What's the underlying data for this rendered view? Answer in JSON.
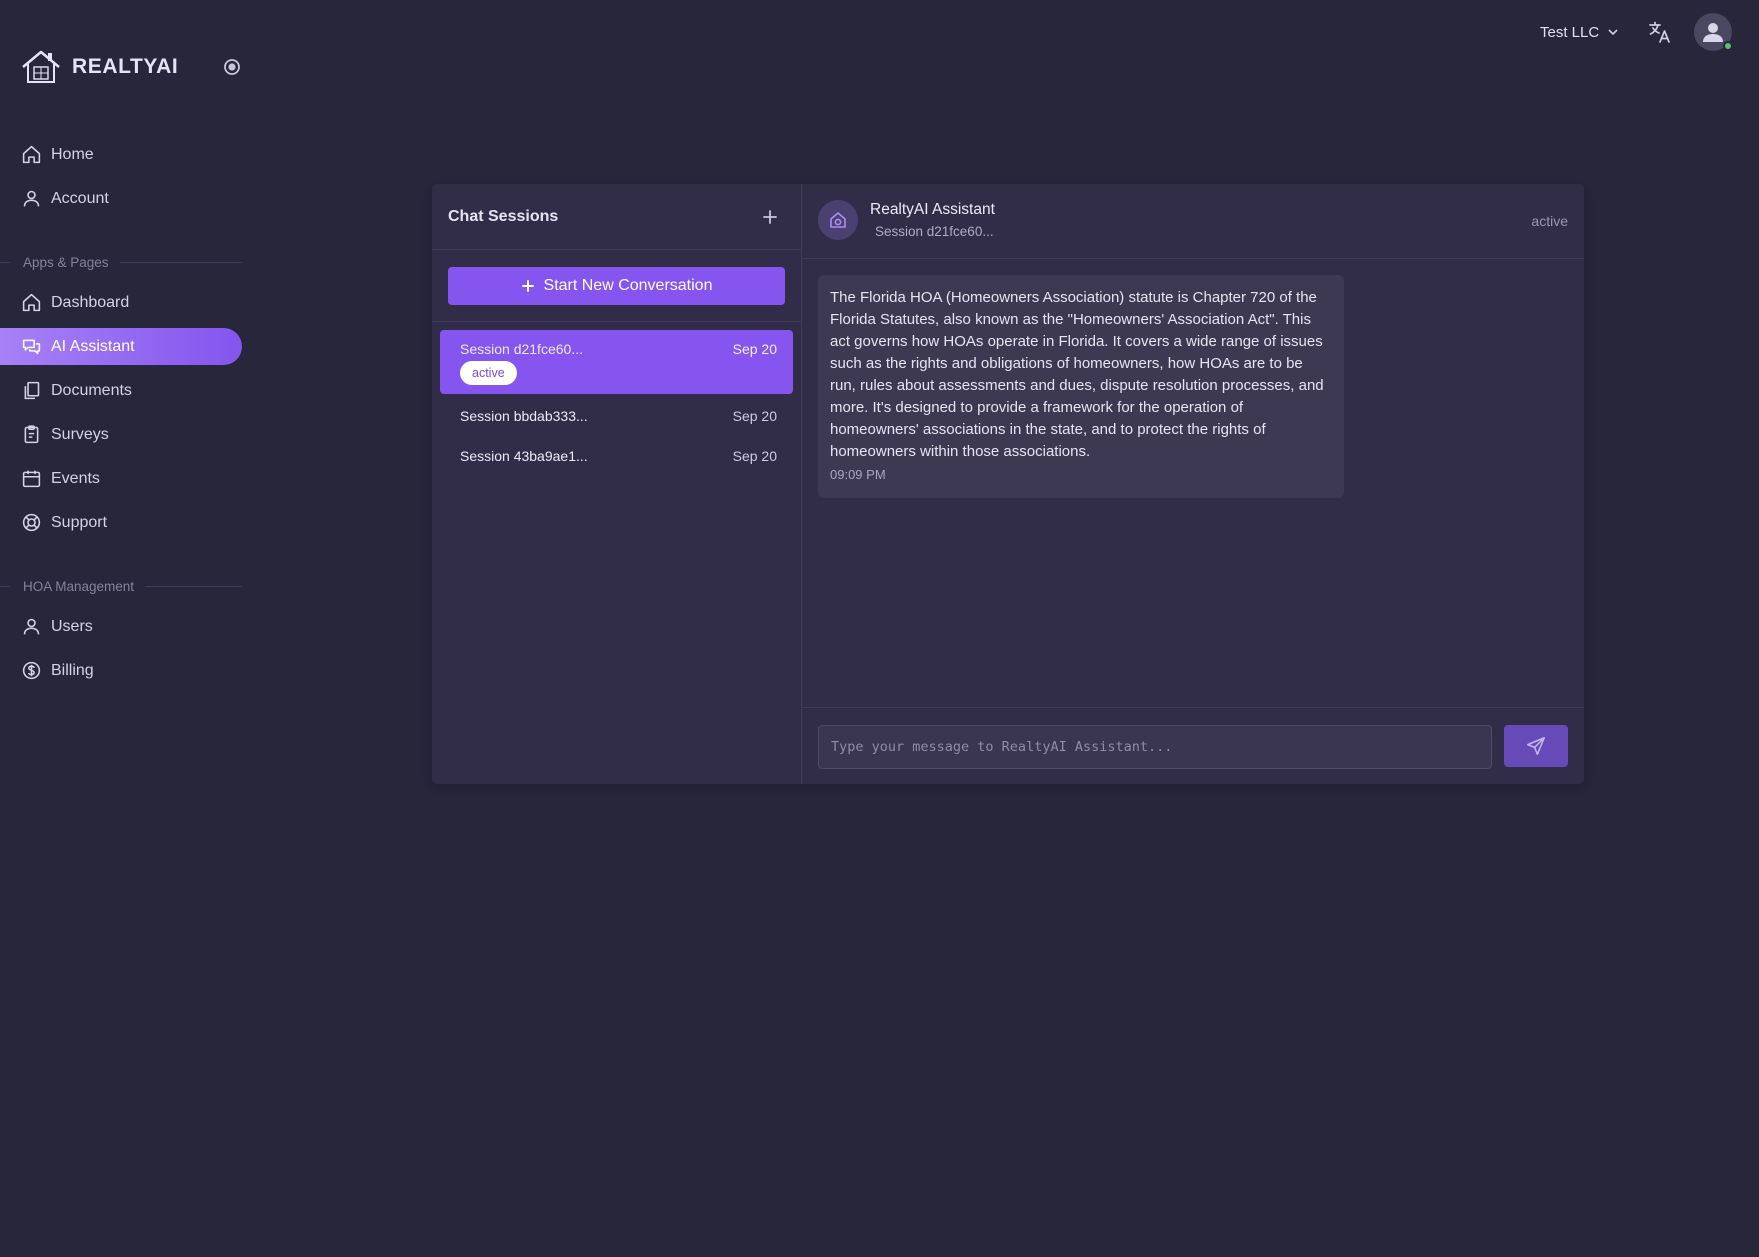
{
  "brand": {
    "name": "REALTYAI"
  },
  "sidebar": {
    "items": [
      {
        "label": "Home",
        "icon": "home-icon"
      },
      {
        "label": "Account",
        "icon": "user-icon"
      }
    ],
    "sections": [
      {
        "header": "Apps & Pages",
        "items": [
          {
            "label": "Dashboard",
            "icon": "home-icon"
          },
          {
            "label": "AI Assistant",
            "icon": "chat-icon",
            "active": true
          },
          {
            "label": "Documents",
            "icon": "documents-icon"
          },
          {
            "label": "Surveys",
            "icon": "clipboard-icon"
          },
          {
            "label": "Events",
            "icon": "calendar-icon"
          },
          {
            "label": "Support",
            "icon": "lifebuoy-icon"
          }
        ]
      },
      {
        "header": "HOA Management",
        "items": [
          {
            "label": "Users",
            "icon": "user-icon"
          },
          {
            "label": "Billing",
            "icon": "dollar-icon"
          }
        ]
      }
    ]
  },
  "topbar": {
    "org": "Test LLC",
    "org_icon": "chevron-down-icon",
    "translate_icon": "translate-icon",
    "online_color": "#5ac26b"
  },
  "chat": {
    "sessions_title": "Chat Sessions",
    "new_button_label": "Start New Conversation",
    "sessions": [
      {
        "name": "Session d21fce60...",
        "date": "Sep 20",
        "badge": "active",
        "selected": true
      },
      {
        "name": "Session bbdab333...",
        "date": "Sep 20"
      },
      {
        "name": "Session 43ba9ae1...",
        "date": "Sep 20"
      }
    ],
    "assistant": {
      "name": "RealtyAI Assistant",
      "session": "Session d21fce60...",
      "status": "active"
    },
    "messages": [
      {
        "text": "The Florida HOA (Homeowners Association) statute is Chapter 720 of the Florida Statutes, also known as the \"Homeowners' Association Act\". This act governs how HOAs operate in Florida. It covers a wide range of issues such as the rights and obligations of homeowners, how HOAs are to be run, rules about assessments and dues, dispute resolution processes, and more. It's designed to provide a framework for the operation of homeowners' associations in the state, and to protect the rights of homeowners within those associations.",
        "time": "09:09 PM"
      }
    ],
    "input": {
      "placeholder": "Type your message to RealtyAI Assistant...",
      "value": ""
    }
  },
  "colors": {
    "accent": "#8654ee",
    "background": "#28263b",
    "card": "#312d49"
  }
}
